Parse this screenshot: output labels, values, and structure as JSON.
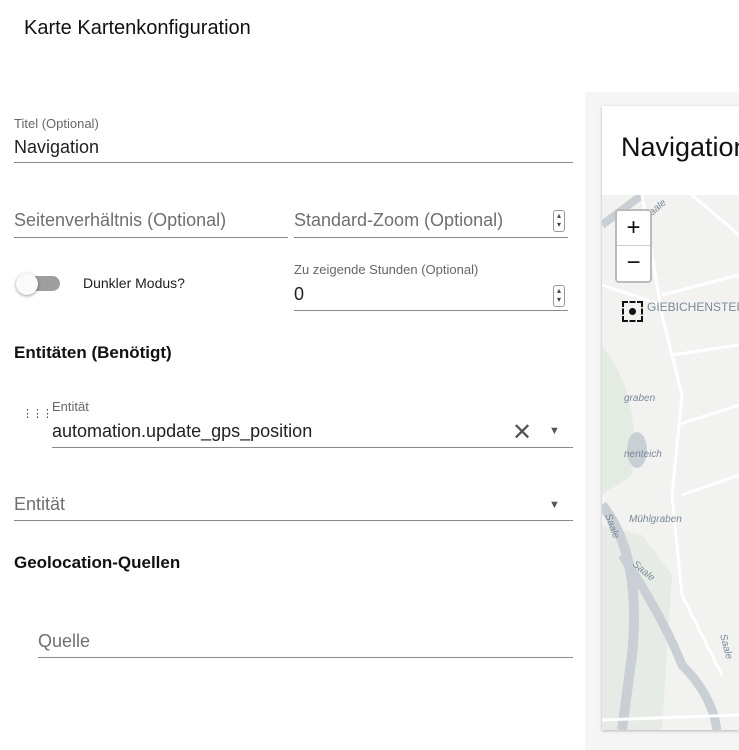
{
  "dialog_title": "Karte Kartenkonfiguration",
  "form": {
    "title_label": "Titel (Optional)",
    "title_value": "Navigation",
    "aspect_placeholder": "Seitenverhältnis (Optional)",
    "zoom_placeholder": "Standard-Zoom (Optional)",
    "dark_mode_label": "Dunkler Modus?",
    "dark_mode_on": false,
    "hours_label": "Zu zeigende Stunden (Optional)",
    "hours_value": "0",
    "entities_heading": "Entitäten (Benötigt)",
    "entity_label": "Entität",
    "entity_value": "automation.update_gps_position",
    "new_entity_placeholder": "Entität",
    "geo_heading": "Geolocation-Quellen",
    "source_placeholder": "Quelle"
  },
  "preview": {
    "card_title": "Navigation",
    "zoom_in": "+",
    "zoom_out": "−",
    "map_labels": [
      "GIEBICHENSTEIN",
      "graben",
      "nenteich",
      "Mühlgraben",
      "Saale",
      "Saale",
      "Saale",
      "Saale"
    ]
  }
}
